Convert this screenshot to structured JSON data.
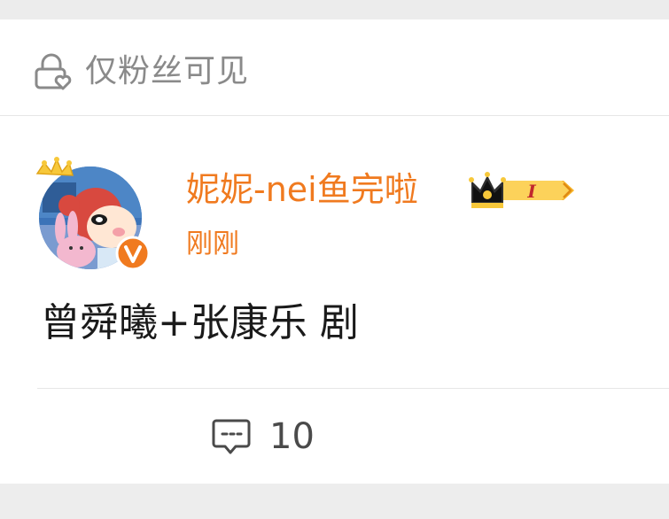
{
  "visibility": {
    "icon": "lock-heart-icon",
    "label": "仅粉丝可见"
  },
  "author": {
    "name": "妮妮-nei鱼完啦",
    "badge_level": "I",
    "verified_mark": "V",
    "avatar": "cartoon-girl-avatar"
  },
  "post": {
    "timestamp": "刚刚",
    "text": "曾舜曦+张康乐 剧"
  },
  "actions": {
    "comment_icon": "comment-icon",
    "comment_count": "10"
  },
  "colors": {
    "accent": "#f07a1f",
    "muted": "#8a8a8a",
    "text": "#1a1a1a",
    "gold": "#f7b52b"
  }
}
